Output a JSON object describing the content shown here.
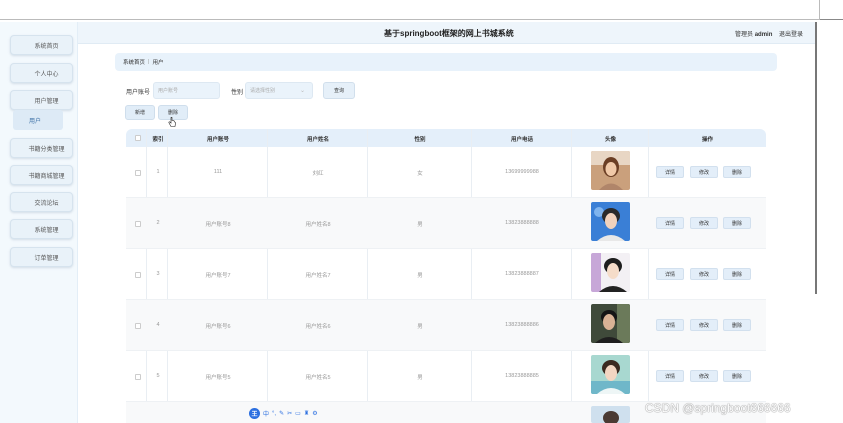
{
  "app": {
    "title": "基于springboot框架的网上书城系统",
    "admin_prefix": "管理员",
    "admin_name": "admin",
    "logout": "退出登录"
  },
  "sidebar": {
    "items": [
      {
        "label": "系统首页"
      },
      {
        "label": "个人中心"
      },
      {
        "label": "用户管理"
      },
      {
        "label": "书籍分类管理"
      },
      {
        "label": "书籍商城管理"
      },
      {
        "label": "交流论坛"
      },
      {
        "label": "系统管理"
      },
      {
        "label": "订单管理"
      }
    ],
    "submenu": {
      "label": "用户"
    }
  },
  "breadcrumb": {
    "home": "系统首页",
    "current": "用户"
  },
  "search": {
    "account_label": "用户账号",
    "account_placeholder": "用户账号",
    "gender_label": "性别",
    "gender_placeholder": "请选择性别",
    "query_label": "查询"
  },
  "actions": {
    "add_label": "新增",
    "delete_label": "删除"
  },
  "table": {
    "headers": [
      "索引",
      "用户账号",
      "用户姓名",
      "性别",
      "用户电话",
      "头像",
      "操作"
    ],
    "rows": [
      {
        "index": "1",
        "account": "111",
        "name": "刘红",
        "gender": "女",
        "phone": "13699999988"
      },
      {
        "index": "2",
        "account": "用户账号8",
        "name": "用户姓名8",
        "gender": "男",
        "phone": "13823888888"
      },
      {
        "index": "3",
        "account": "用户账号7",
        "name": "用户姓名7",
        "gender": "男",
        "phone": "13823888887"
      },
      {
        "index": "4",
        "account": "用户账号6",
        "name": "用户姓名6",
        "gender": "男",
        "phone": "13823888886"
      },
      {
        "index": "5",
        "account": "用户账号5",
        "name": "用户姓名5",
        "gender": "男",
        "phone": "13823888885"
      }
    ],
    "op_labels": {
      "detail": "详情",
      "edit": "修改",
      "delete": "删除"
    }
  },
  "ime": {
    "logo": "王",
    "mode": "中"
  },
  "watermark": "CSDN @springboot666666",
  "colors": {
    "accent": "#e4effa",
    "sidebar_bg": "#f3f9fd",
    "button_bg": "#e3eef9"
  }
}
